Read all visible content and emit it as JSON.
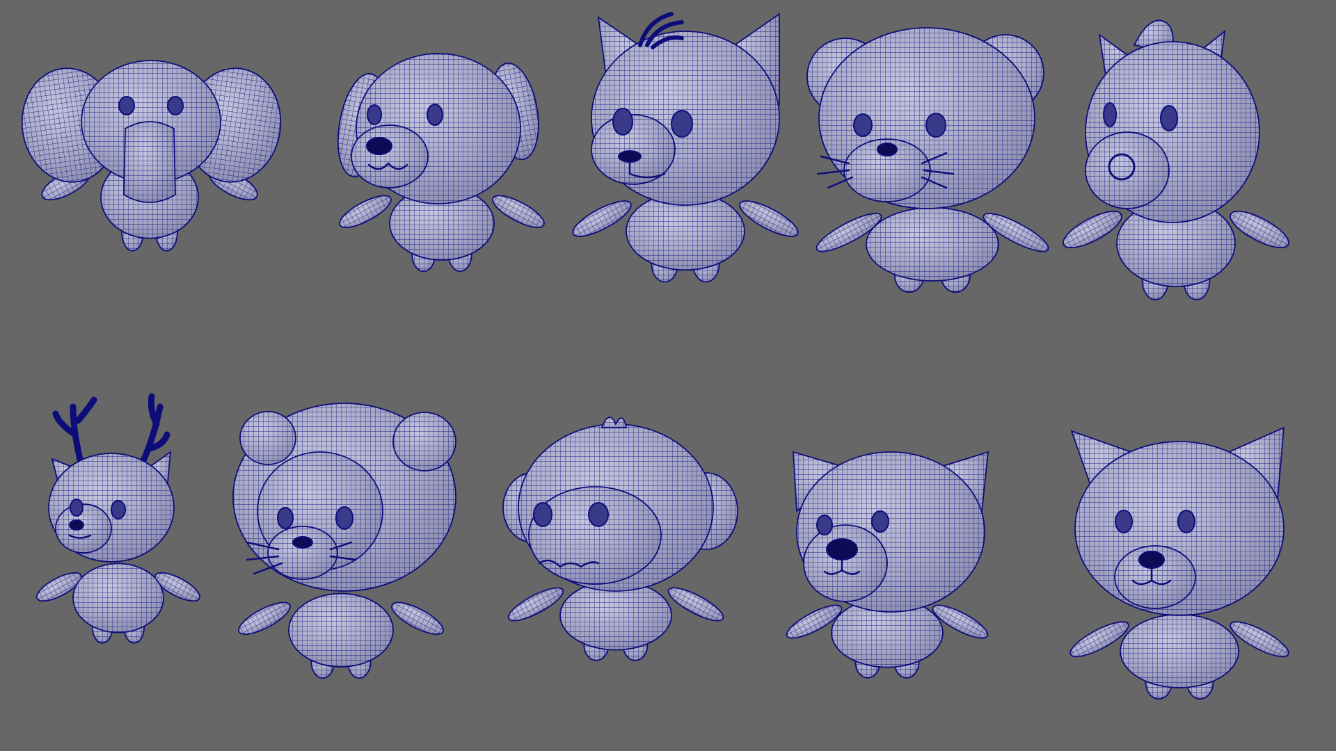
{
  "viewport": {
    "background": "#676767",
    "mesh_fill": "#a7a8c6",
    "wire_color": "#0d0d7a",
    "shade_color": "#8c8db0",
    "highlight_color": "#c8b7c2"
  },
  "models": [
    {
      "id": "elephant",
      "kind": "elephant-character-wireframe",
      "row": 1,
      "col": 1
    },
    {
      "id": "dog",
      "kind": "dog-character-wireframe",
      "row": 1,
      "col": 2
    },
    {
      "id": "fox",
      "kind": "fox-character-wireframe",
      "row": 1,
      "col": 3
    },
    {
      "id": "cat",
      "kind": "cat-character-wireframe",
      "row": 1,
      "col": 4
    },
    {
      "id": "horse",
      "kind": "horse-character-wireframe",
      "row": 1,
      "col": 5
    },
    {
      "id": "deer",
      "kind": "deer-character-wireframe",
      "row": 2,
      "col": 1
    },
    {
      "id": "lion",
      "kind": "lion-character-wireframe",
      "row": 2,
      "col": 2
    },
    {
      "id": "monkey",
      "kind": "monkey-character-wireframe",
      "row": 2,
      "col": 3
    },
    {
      "id": "bear",
      "kind": "bear-character-wireframe",
      "row": 2,
      "col": 4
    },
    {
      "id": "wolf",
      "kind": "wolf-character-wireframe",
      "row": 2,
      "col": 5
    }
  ]
}
